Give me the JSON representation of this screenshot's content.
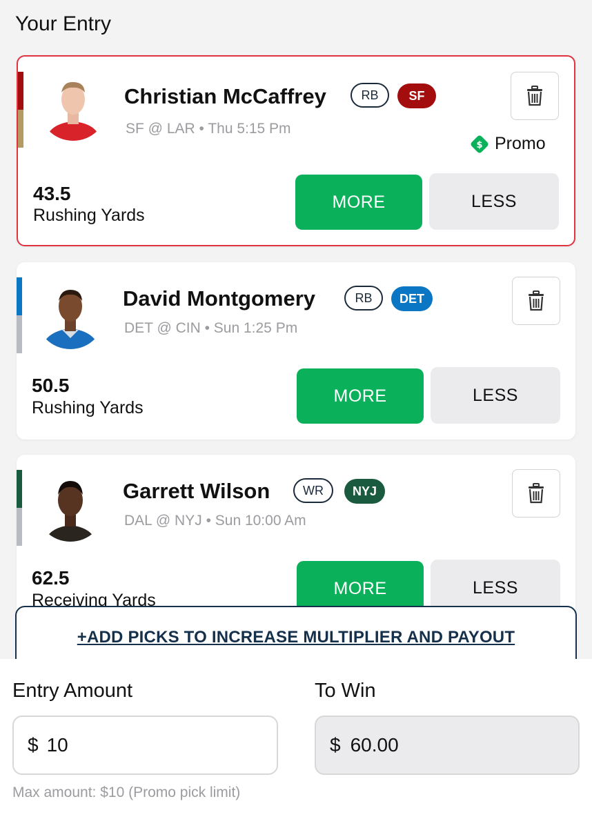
{
  "header": {
    "title": "Your Entry"
  },
  "picks": [
    {
      "name": "Christian McCaffrey",
      "position": "RB",
      "team": "SF",
      "team_color": "#a30d0d",
      "stripe_colors": [
        "#a30d0d",
        "#b59a64"
      ],
      "game": "SF @ LAR • Thu 5:15 Pm",
      "promo": "Promo",
      "line": "43.5",
      "stat": "Rushing Yards",
      "more_label": "MORE",
      "less_label": "LESS",
      "selected": true
    },
    {
      "name": "David Montgomery",
      "position": "RB",
      "team": "DET",
      "team_color": "#0a76c4",
      "stripe_colors": [
        "#0a76c4",
        "#b8bcc2"
      ],
      "game": "DET @ CIN • Sun 1:25 Pm",
      "line": "50.5",
      "stat": "Rushing Yards",
      "more_label": "MORE",
      "less_label": "LESS",
      "selected": false
    },
    {
      "name": "Garrett Wilson",
      "position": "WR",
      "team": "NYJ",
      "team_color": "#1a5b3f",
      "stripe_colors": [
        "#1a5b3f",
        "#b8bcc2"
      ],
      "game": "DAL @ NYJ • Sun 10:00 Am",
      "line": "62.5",
      "stat": "Receiving Yards",
      "more_label": "MORE",
      "less_label": "LESS",
      "selected": false
    }
  ],
  "add_picks_label": "+ADD PICKS TO INCREASE MULTIPLIER AND PAYOUT",
  "entry": {
    "amount_label": "Entry Amount",
    "currency": "$",
    "amount_value": "10",
    "to_win_label": "To Win",
    "to_win_value": "60.00",
    "helper_text": "Max amount: $10 (Promo pick limit)"
  },
  "colors": {
    "more_green": "#0bb15a",
    "selected_border": "#e0323f",
    "navy": "#15304a"
  }
}
